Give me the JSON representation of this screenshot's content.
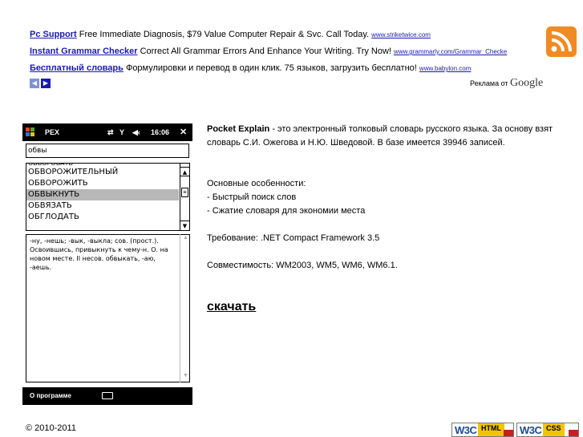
{
  "ads": [
    {
      "title": "Pc Support",
      "text": "Free Immediate Diagnosis, $79 Value Computer Repair & Svc. Call Today.",
      "url": "www.striketwice.com"
    },
    {
      "title": "Instant Grammar Checker",
      "text": "Correct All Grammar Errors And Enhance Your Writing. Try Now!",
      "url": "www.grammarly.com/Grammar_Checke"
    },
    {
      "title": "Бесплатный словарь",
      "text": "Формулировки и перевод в один клик. 75 языков, загрузить бесплатно!",
      "url": "www.babylon.com"
    }
  ],
  "ads_by": {
    "prefix": "Реклама от",
    "brand": "Google"
  },
  "device": {
    "app_title": "PEX",
    "time": "16:06",
    "search_value": "обвы",
    "list_partial": "ОБВОРОВАТЬ",
    "list": [
      "ОБВОРОЖИТЕЛЬНЫЙ",
      "ОБВОРОЖИТЬ",
      "ОБВЫКНУТЬ",
      "ОБВЯЗАТЬ",
      "ОБГЛОДАТЬ"
    ],
    "selected_index": 2,
    "definition": "-ну, -нешь; -вык, -выкла; сов. (прост.). Освоившись, привыкнуть к чему-н. О. на новом месте. II несов. обвыкать, -аю, -аешь.",
    "menu_about": "О программе",
    "colors": {
      "bar": "#000000",
      "selected": "#b7b7b7"
    }
  },
  "description": {
    "app_name": "Pocket Explain",
    "intro": " - это электронный толковый словарь русского языка. За основу взят словарь С.И. Ожегова и Н.Ю. Шведовой. В базе имеется 39946 записей.",
    "features_heading": "Основные особенности:",
    "features": [
      "- Быстрый поиск слов",
      "- Сжатие словаря для экономии места"
    ],
    "requirement": "Требование: .NET Compact Framework 3.5",
    "compat": "Совместимость: WM2003, WM5, WM6, WM6.1.",
    "download": "скачать"
  },
  "footer": {
    "copyright": "© 2010-2011",
    "badges": [
      {
        "w3c": "W3C",
        "lang": "HTML"
      },
      {
        "w3c": "W3C",
        "lang": "CSS"
      }
    ]
  },
  "colors": {
    "ad_link": "#1a1ab2",
    "rss": "#f08a24"
  }
}
